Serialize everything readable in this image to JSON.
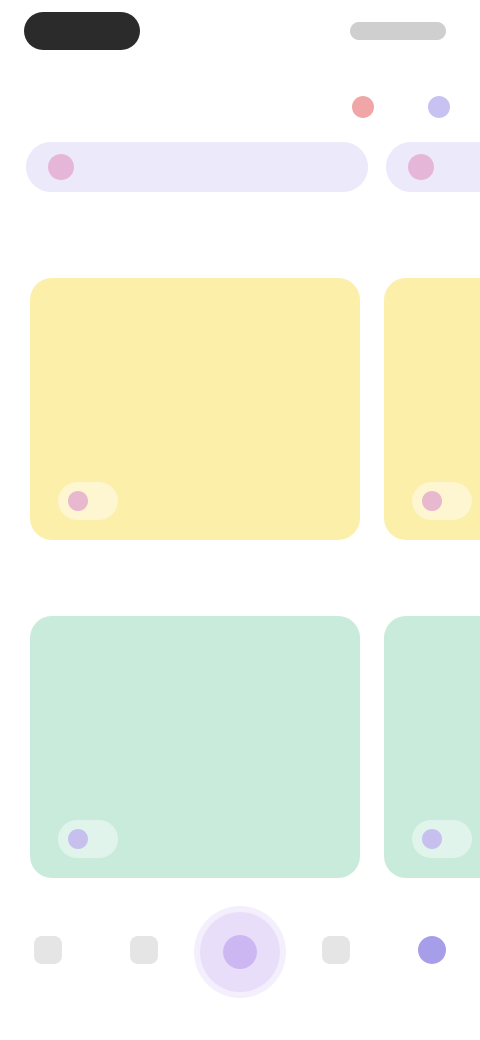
{
  "header": {
    "title": ""
  },
  "chips": [
    {
      "label": ""
    },
    {
      "label": ""
    }
  ],
  "sections": [
    {
      "heading": "",
      "see_all": "",
      "cards": [
        {
          "text": "",
          "tag": ""
        },
        {
          "text": "",
          "tag": ""
        }
      ]
    },
    {
      "heading": "",
      "see_all": "",
      "cards": [
        {
          "text": "",
          "tag": ""
        },
        {
          "text": "",
          "tag": ""
        }
      ]
    }
  ],
  "nav": {
    "items": [
      {
        "label": ""
      },
      {
        "label": ""
      },
      {
        "label": ""
      },
      {
        "label": ""
      }
    ]
  },
  "colors": {
    "accent": "#a79ee9",
    "card_yellow": "#fbefa9",
    "card_green": "#c9ebdc",
    "chip_bg": "#ece9fb"
  }
}
